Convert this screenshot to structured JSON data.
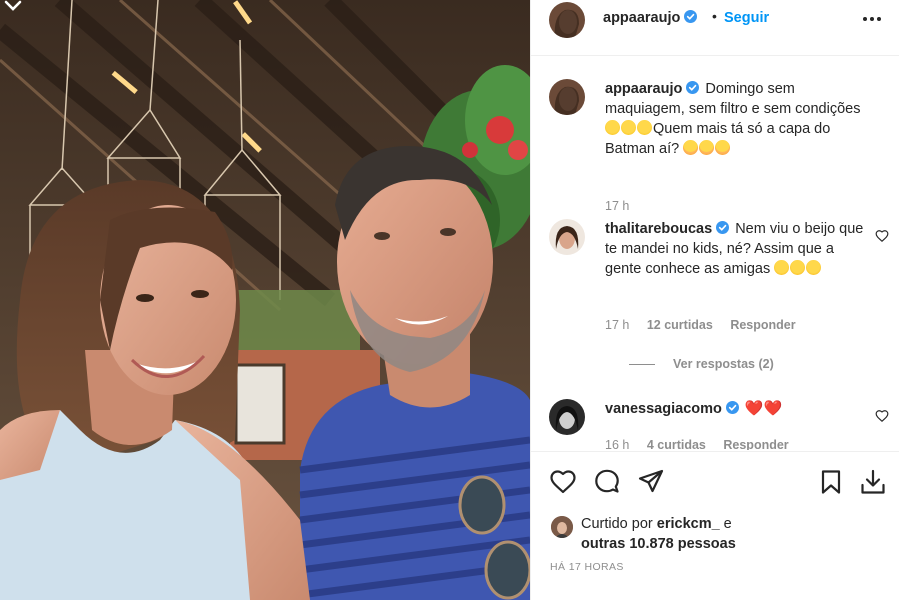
{
  "post": {
    "username": "appaaraujo",
    "follow_label": "Seguir",
    "dot": "•"
  },
  "caption": {
    "username": "appaaraujo",
    "text_part1": "Domingo sem maquiagem, sem filtro e sem condições ",
    "text_part2": "Quem mais tá só a capa do Batman aí? ",
    "time": "17 h"
  },
  "comments": [
    {
      "username": "thalitareboucas",
      "text": "Nem viu o beijo que te mandei no kids, né? Assim que a gente conhece as amigas ",
      "time": "17 h",
      "likes": "12 curtidas",
      "reply": "Responder",
      "view_replies": "Ver respostas (2)"
    },
    {
      "username": "vanessagiacomo",
      "text": "❤️❤️",
      "time": "16 h",
      "likes": "4 curtidas",
      "reply": "Responder"
    }
  ],
  "likes": {
    "prefix": "Curtido por ",
    "user": "erickcm_",
    "middle": " e",
    "others": "outras 10.878 pessoas"
  },
  "timestamp": "HÁ 17 HORAS",
  "icons": {
    "verified": "verified-badge-icon",
    "more": "more-options-icon",
    "like": "heart-icon",
    "comment": "comment-bubble-icon",
    "share": "paper-plane-icon",
    "save": "bookmark-icon",
    "download": "download-icon"
  },
  "colors": {
    "accent": "#0095f6",
    "text": "#262626",
    "muted": "#8e8e8e",
    "heart": "#e0245e"
  }
}
